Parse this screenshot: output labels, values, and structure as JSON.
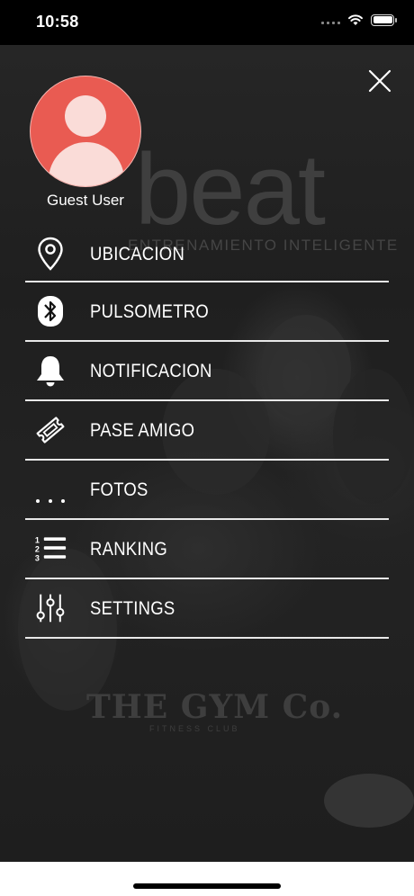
{
  "status_bar": {
    "time": "10:58"
  },
  "background": {
    "brand_logo": "beat",
    "brand_tagline": "ENTRENAMIENTO INTELIGENTE",
    "gym_logo": "THE GYM Co.",
    "gym_tagline": "FITNESS CLUB"
  },
  "user": {
    "name": "Guest User",
    "avatar_color": "#e95b52"
  },
  "menu": {
    "items": [
      {
        "label": "UBICACION",
        "icon": "location-pin-icon"
      },
      {
        "label": "PULSOMETRO",
        "icon": "bluetooth-icon"
      },
      {
        "label": "NOTIFICACION",
        "icon": "bell-icon"
      },
      {
        "label": "PASE AMIGO",
        "icon": "ticket-icon"
      },
      {
        "label": "FOTOS",
        "icon": "more-dots-icon"
      },
      {
        "label": "RANKING",
        "icon": "ranked-list-icon"
      },
      {
        "label": "SETTINGS",
        "icon": "sliders-icon"
      }
    ]
  }
}
